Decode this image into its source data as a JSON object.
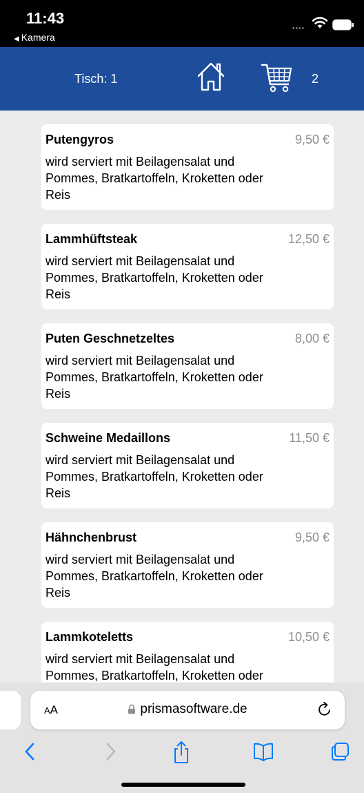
{
  "status": {
    "time": "11:43",
    "back_app": "Kamera",
    "back_icon": "left-triangle-icon"
  },
  "header": {
    "table_label": "Tisch: 1",
    "home_icon": "home-icon",
    "cart_icon": "cart-icon",
    "cart_count": "2",
    "brand_color": "#1e4d9b"
  },
  "menu": {
    "items": [
      {
        "name": "Putengyros",
        "price": "9,50 €",
        "description": "wird serviert mit Beilagensalat und Pommes, Bratkartoffeln, Kroketten oder Reis"
      },
      {
        "name": "Lammhüftsteak",
        "price": "12,50 €",
        "description": "wird serviert mit Beilagensalat und Pommes, Bratkartoffeln, Kroketten oder Reis"
      },
      {
        "name": "Puten Geschnetzeltes",
        "price": "8,00 €",
        "description": "wird serviert mit Beilagensalat und Pommes, Bratkartoffeln, Kroketten oder Reis"
      },
      {
        "name": "Schweine Medaillons",
        "price": "11,50 €",
        "description": "wird serviert mit Beilagensalat und Pommes, Bratkartoffeln, Kroketten oder Reis"
      },
      {
        "name": "Hähnchenbrust",
        "price": "9,50 €",
        "description": "wird serviert mit Beilagensalat und Pommes, Bratkartoffeln, Kroketten oder Reis"
      },
      {
        "name": "Lammkoteletts",
        "price": "10,50 €",
        "description": "wird serviert mit Beilagensalat und Pommes, Bratkartoffeln, Kroketten oder Reis"
      }
    ]
  },
  "browser": {
    "aa_label_small": "A",
    "aa_label": "A",
    "url": "prismasoftware.de",
    "lock_icon": "lock-icon",
    "reload_icon": "reload-icon",
    "toolbar_icons": [
      "back-chevron-icon",
      "forward-chevron-icon",
      "share-icon",
      "bookmarks-icon",
      "tabs-icon"
    ],
    "accent_color": "#007aff"
  }
}
